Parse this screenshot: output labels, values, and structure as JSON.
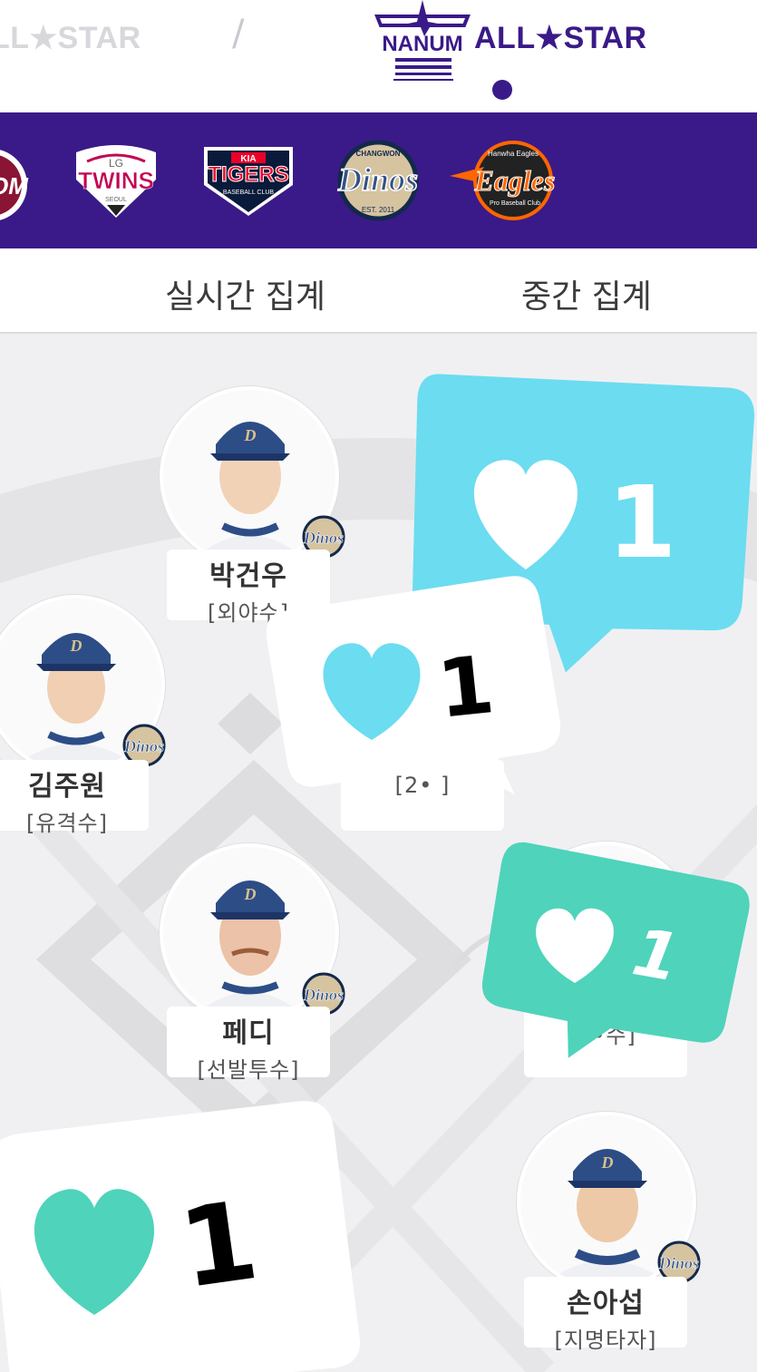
{
  "header": {
    "tab_left": "LL★STAR",
    "separator": "/",
    "tab_right": "ALL★STAR",
    "logo_text": "NANUM"
  },
  "teams": [
    {
      "name": "heroes",
      "label": "OM"
    },
    {
      "name": "lg-twins",
      "label_top": "LG",
      "label": "TWINS",
      "label_sub": "SEOUL"
    },
    {
      "name": "kia-tigers",
      "label_top": "KIA",
      "label": "TIGERS",
      "label_sub": "BASEBALL CLUB"
    },
    {
      "name": "nc-dinos",
      "label_top": "CHANGWON",
      "label": "Dinos",
      "label_sub": "EST. 2011"
    },
    {
      "name": "hanwha-eagles",
      "label_top": "Hanwha Eagles",
      "label": "Eagles",
      "label_sub": "Pro Baseball Club"
    }
  ],
  "subtabs": [
    "실시간 집계",
    "중간 집계"
  ],
  "players": [
    {
      "name": "박건우",
      "position": "[외야수]"
    },
    {
      "name": "김주원",
      "position": "[유격수]"
    },
    {
      "name": "",
      "position": "[2•  ]"
    },
    {
      "name": "페디",
      "position": "[선발투수]"
    },
    {
      "name": "",
      "position": "[  •수]"
    },
    {
      "name": "손아섭",
      "position": "[지명타자]"
    }
  ],
  "like_bubbles": [
    {
      "count": "1",
      "color": "#6cdcf0"
    },
    {
      "count": "1",
      "color": "#ffffff"
    },
    {
      "count": "1",
      "color": "#4fd3bb"
    },
    {
      "count": "1",
      "color": "#ffffff"
    }
  ],
  "colors": {
    "brand_purple": "#3a1a88",
    "like_blue": "#6cdcf0",
    "like_green": "#4fd3bb"
  }
}
